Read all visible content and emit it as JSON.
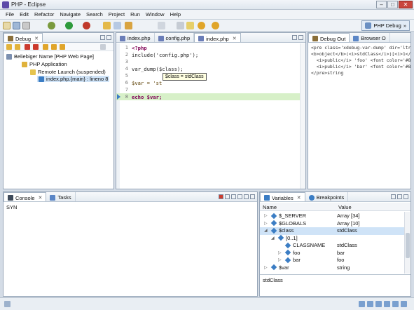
{
  "window": {
    "title": "PHP - Eclipse",
    "minimize": "–",
    "maximize": "□",
    "close": "✕"
  },
  "menu": [
    "File",
    "Edit",
    "Refactor",
    "Navigate",
    "Search",
    "Project",
    "Run",
    "Window",
    "Help"
  ],
  "perspective": {
    "label": "PHP Debug",
    "toggle": "»"
  },
  "debug_view": {
    "tab": "Debug",
    "tree": [
      {
        "label": "Beliebiger Name [PHP Web Page]"
      },
      {
        "label": "PHP Application"
      },
      {
        "label": "Remote Launch (suspended)"
      },
      {
        "label": "index.php.{main} : lineno 8"
      }
    ]
  },
  "editor": {
    "tabs": [
      "index.php",
      "config.php",
      "index.php"
    ],
    "lines": [
      {
        "n": "1",
        "text": "<?php"
      },
      {
        "n": "2",
        "text": "include('config.php');"
      },
      {
        "n": "3",
        "text": ""
      },
      {
        "n": "4",
        "text": "var_dump($class);"
      },
      {
        "n": "5",
        "text": ""
      },
      {
        "n": "6",
        "text": "$var = 'st"
      },
      {
        "n": "7",
        "text": ""
      },
      {
        "n": "8",
        "text": "echo $var;"
      }
    ],
    "tooltip": "$class = stdClass"
  },
  "debug_output": {
    "tabs": [
      "Debug Out",
      "Browser O"
    ],
    "lines": [
      "<pre class='xdebug-var-dump' dir='ltr'>",
      "<b>object</b>(<i>stdClass</i>)[<i>1</i>",
      "  <i>public</i> 'foo' <font color='#888a85",
      "  <i>public</i> 'bar' <font color='#888a85",
      "</pre>string"
    ]
  },
  "console": {
    "tabs": [
      "Console",
      "Tasks"
    ],
    "content": "SYN"
  },
  "variables": {
    "tabs": [
      "Variables",
      "Breakpoints"
    ],
    "headers": {
      "name": "Name",
      "value": "Value"
    },
    "rows": [
      {
        "name": "$_SERVER",
        "value": "Array [34]",
        "expander": "▷"
      },
      {
        "name": "$GLOBALS",
        "value": "Array [10]",
        "expander": "▷"
      },
      {
        "name": "$class",
        "value": "stdClass",
        "expander": "◢"
      },
      {
        "name": "[0..1]",
        "value": "",
        "expander": "◢"
      },
      {
        "name": "CLASSNAME",
        "value": "stdClass",
        "expander": ""
      },
      {
        "name": "foo",
        "value": "bar",
        "expander": "▷"
      },
      {
        "name": "bar",
        "value": "foo",
        "expander": "▷"
      },
      {
        "name": "$var",
        "value": "string",
        "expander": "▷"
      }
    ],
    "detail": "stdClass"
  },
  "colors": {
    "accent": "#3b7dc4",
    "selection": "#cfe3f7",
    "current_line": "#d7f0c8"
  }
}
